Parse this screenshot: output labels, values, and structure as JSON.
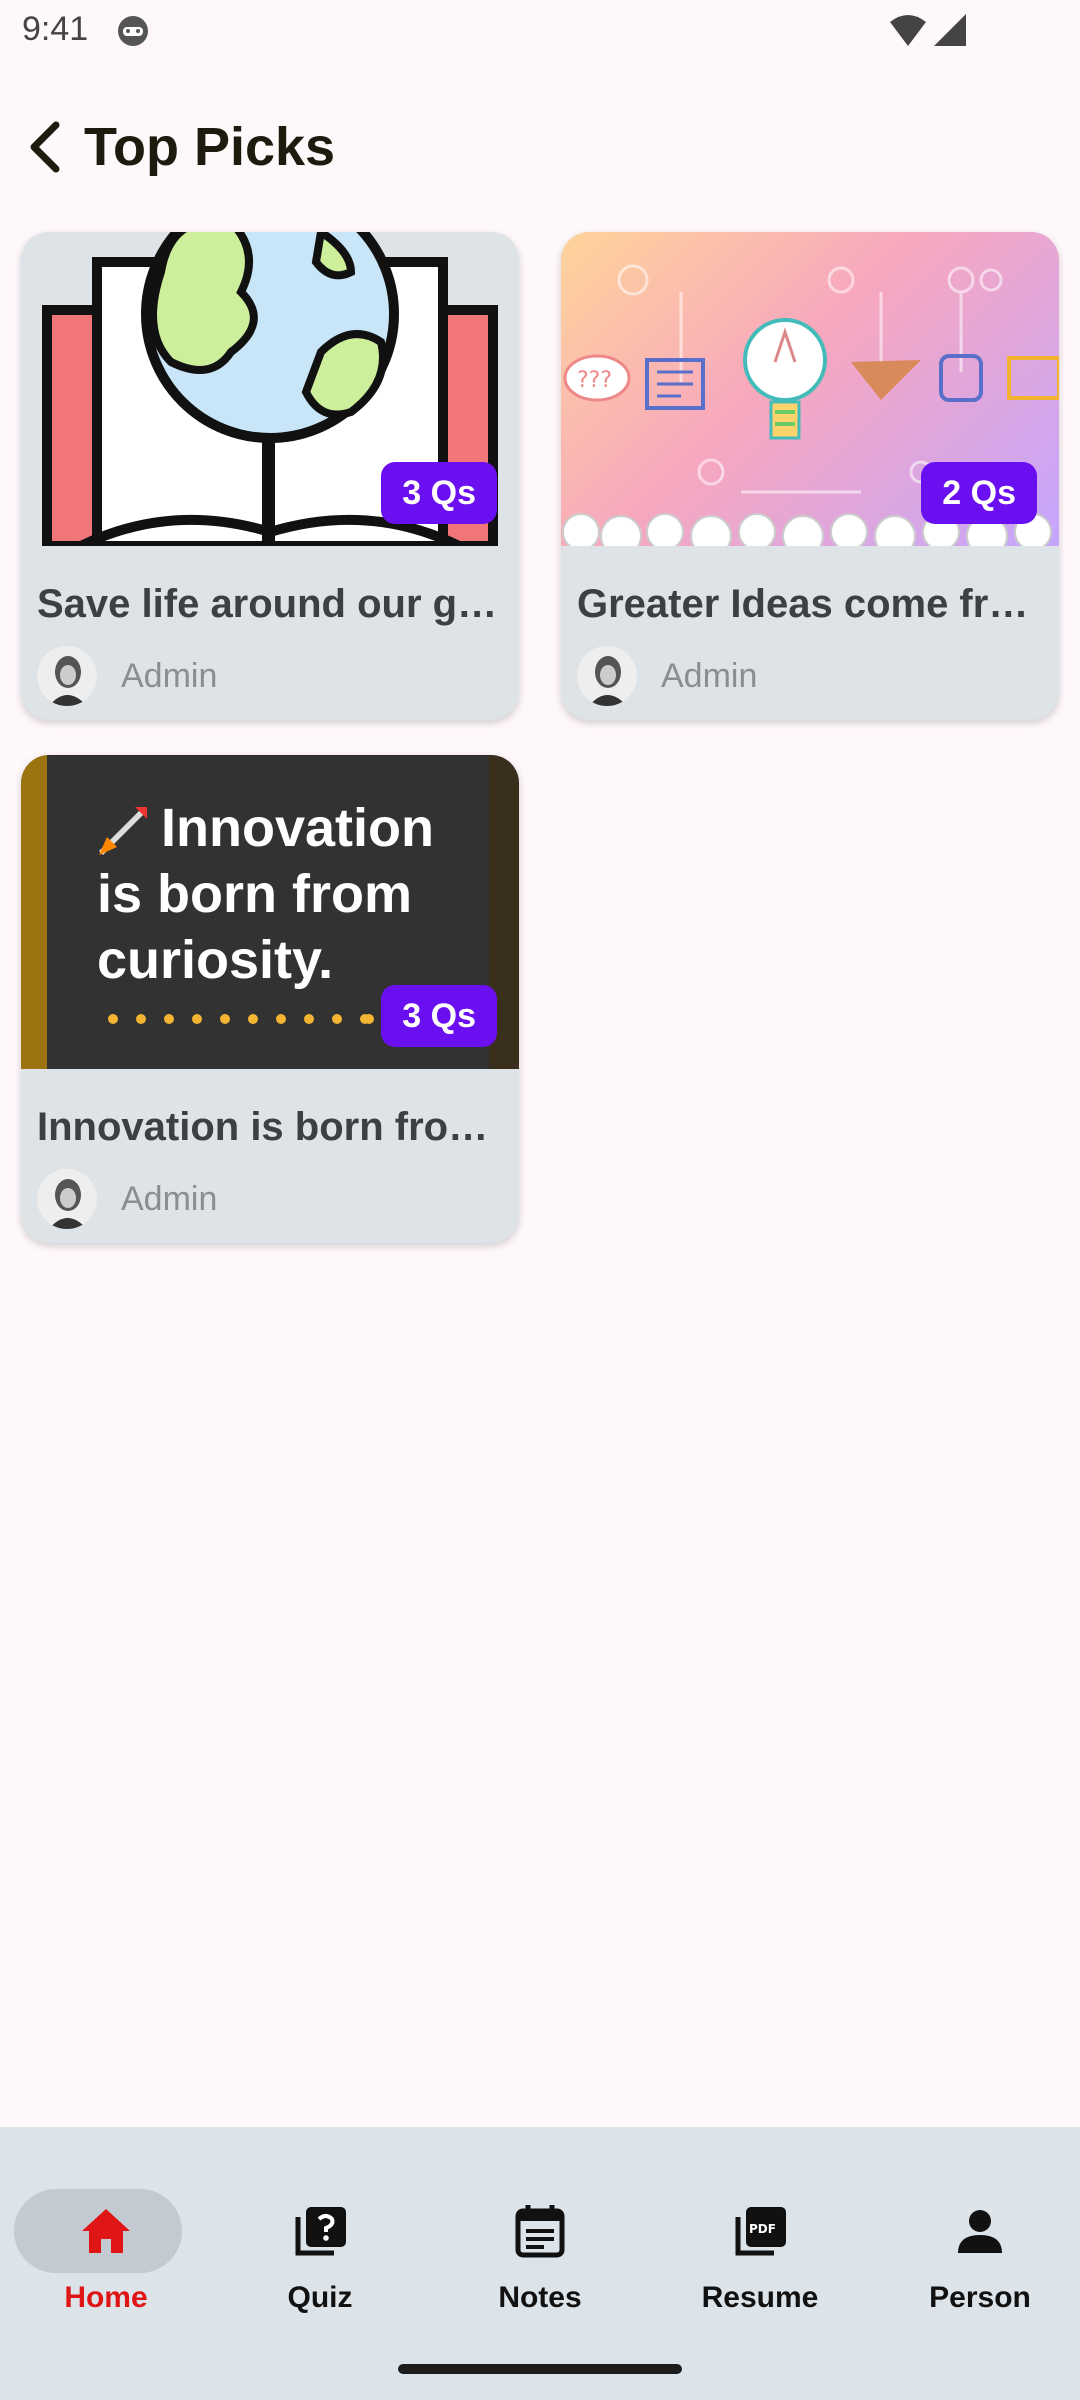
{
  "status_bar": {
    "time": "9:41"
  },
  "header": {
    "title": "Top Picks"
  },
  "cards": [
    {
      "title": "Save life around our gr…",
      "badge": "3 Qs",
      "author": "Admin"
    },
    {
      "title": "Greater Ideas come fro…",
      "badge": "2 Qs",
      "author": "Admin"
    },
    {
      "title": "Innovation is born fro…",
      "badge": "3 Qs",
      "author": "Admin",
      "thumb_text": [
        "Innovation",
        "is born from",
        "curiosity."
      ]
    }
  ],
  "bottom_nav": {
    "items": [
      {
        "label": "Home",
        "icon": "home-icon",
        "active": true
      },
      {
        "label": "Quiz",
        "icon": "quiz-icon",
        "active": false
      },
      {
        "label": "Notes",
        "icon": "notes-icon",
        "active": false
      },
      {
        "label": "Resume",
        "icon": "pdf-icon",
        "active": false
      },
      {
        "label": "Person",
        "icon": "person-icon",
        "active": false
      }
    ]
  },
  "colors": {
    "accent": "#6a0ff0",
    "active_nav": "#e01616",
    "card_bg": "#dde3e7",
    "nav_bg": "#dce3e9"
  }
}
